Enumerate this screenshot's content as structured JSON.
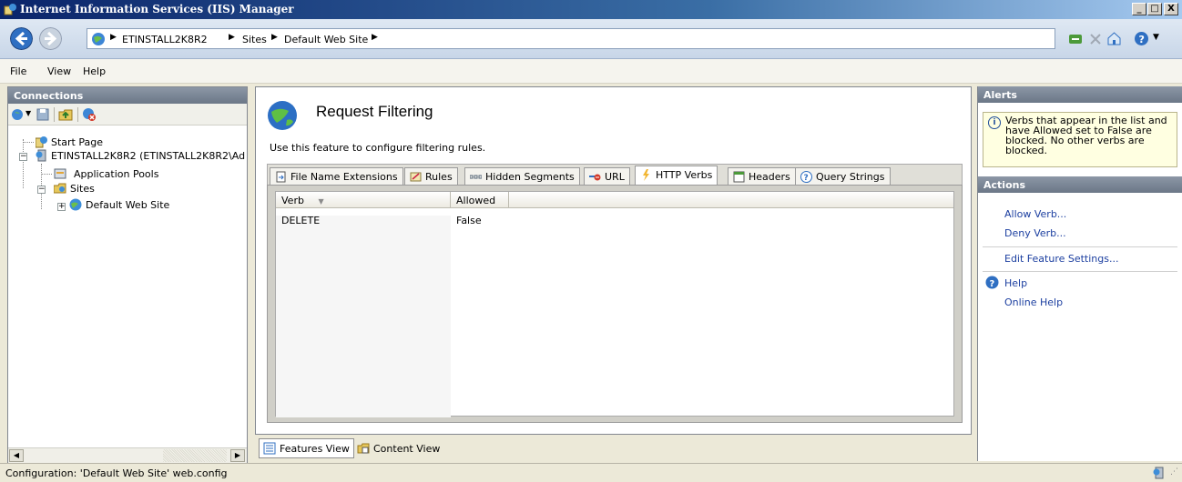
{
  "window": {
    "title": "Internet Information Services (IIS) Manager",
    "controls": {
      "minimize": "_",
      "maximize": "□",
      "close": "X"
    }
  },
  "address": {
    "crumbs": [
      "ETINSTALL2K8R2",
      "Sites",
      "Default Web Site"
    ],
    "separator": "▶"
  },
  "menu": {
    "items": [
      "File",
      "View",
      "Help"
    ]
  },
  "connections": {
    "header": "Connections",
    "tree": {
      "start_page": "Start Page",
      "server": "ETINSTALL2K8R2 (ETINSTALL2K8R2\\Ad",
      "app_pools": "Application Pools",
      "sites": "Sites",
      "default_site": "Default Web Site"
    }
  },
  "feature": {
    "title": "Request Filtering",
    "description": "Use this feature to configure filtering rules.",
    "tabs": [
      "File Name Extensions",
      "Rules",
      "Hidden Segments",
      "URL",
      "HTTP Verbs",
      "Headers",
      "Query Strings"
    ],
    "active_tab": "HTTP Verbs",
    "grid": {
      "columns": [
        "Verb",
        "Allowed"
      ],
      "rows": [
        {
          "verb": "DELETE",
          "allowed": "False"
        }
      ]
    }
  },
  "view_switch": {
    "features_view": "Features View",
    "content_view": "Content View"
  },
  "alerts": {
    "header": "Alerts",
    "message": "Verbs that appear in the list and have Allowed set to False are blocked. No other verbs are blocked."
  },
  "actions": {
    "header": "Actions",
    "allow_verb": "Allow Verb...",
    "deny_verb": "Deny Verb...",
    "edit_feature_settings": "Edit Feature Settings...",
    "help": "Help",
    "online_help": "Online Help"
  },
  "status": {
    "text": "Configuration: 'Default Web Site' web.config"
  },
  "colors": {
    "link": "#1c3fa0",
    "alert_bg": "#ffffe1",
    "title_gradient_start": "#0a246a"
  }
}
